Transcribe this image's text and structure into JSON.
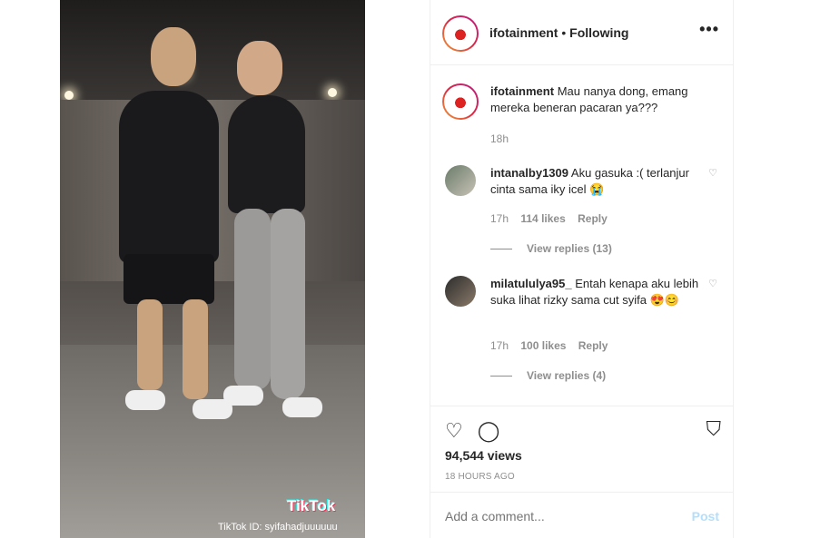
{
  "video": {
    "tiktok_logo": "TikTok",
    "tiktok_id": "TikTok ID: syifahadjuuuuuu"
  },
  "header": {
    "username": "ifotainment",
    "separator": " • ",
    "follow_status": "Following",
    "more": "•••"
  },
  "comments": [
    {
      "username": "ifotainment",
      "text": "Mau nanya dong, emang mereka beneran pacaran ya???",
      "time": "18h"
    },
    {
      "username": "intanalby1309",
      "text": "Aku gasuka :( terlanjur cinta sama iky icel 😭",
      "time": "17h",
      "likes": "114 likes",
      "reply": "Reply",
      "view_replies": "View replies (13)"
    },
    {
      "username": "milatululya95_",
      "text": "Entah kenapa aku lebih suka lihat rizky sama cut syifa 😍😊",
      "time": "17h",
      "likes": "100 likes",
      "reply": "Reply",
      "view_replies": "View replies (4)"
    }
  ],
  "actions": {
    "like_icon": "♡",
    "comment_icon": "◯",
    "save_icon": "⛉",
    "views": "94,544 views",
    "timestamp": "18 HOURS AGO"
  },
  "add_comment": {
    "placeholder": "Add a comment...",
    "post_label": "Post"
  }
}
